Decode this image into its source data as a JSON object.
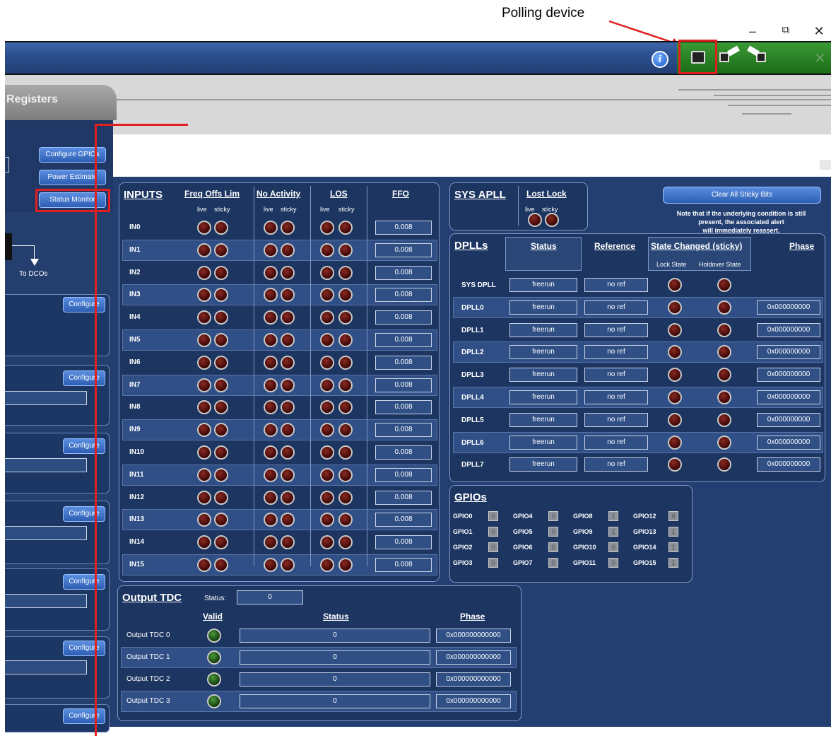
{
  "annotation": {
    "polling_label": "Polling device"
  },
  "window": {
    "minimize": "–",
    "restore": "⧉",
    "close": "✕"
  },
  "toolbar": {
    "info": "i"
  },
  "tab": {
    "label": "Registers"
  },
  "left": {
    "buttons": [
      "Configure GPIOs",
      "Power Estimate",
      "Status Monitor"
    ],
    "to_dcos": "To DCOs",
    "configure": "Configure"
  },
  "inputs": {
    "title": "INPUTS",
    "headers": [
      "Freq Offs Lim",
      "No Activity",
      "LOS",
      "FFO"
    ],
    "sub": [
      "live",
      "sticky"
    ],
    "rows": [
      {
        "name": "IN0",
        "ffo": "0.008"
      },
      {
        "name": "IN1",
        "ffo": "0.008"
      },
      {
        "name": "IN2",
        "ffo": "0.008"
      },
      {
        "name": "IN3",
        "ffo": "0.008"
      },
      {
        "name": "IN4",
        "ffo": "0.008"
      },
      {
        "name": "IN5",
        "ffo": "0.008"
      },
      {
        "name": "IN6",
        "ffo": "0.008"
      },
      {
        "name": "IN7",
        "ffo": "0.008"
      },
      {
        "name": "IN8",
        "ffo": "0.008"
      },
      {
        "name": "IN9",
        "ffo": "0.008"
      },
      {
        "name": "IN10",
        "ffo": "0.008"
      },
      {
        "name": "IN11",
        "ffo": "0.008"
      },
      {
        "name": "IN12",
        "ffo": "0.008"
      },
      {
        "name": "IN13",
        "ffo": "0.008"
      },
      {
        "name": "IN14",
        "ffo": "0.008"
      },
      {
        "name": "IN15",
        "ffo": "0.008"
      }
    ]
  },
  "sysapll": {
    "title": "SYS APLL",
    "header": "Lost Lock",
    "sub": [
      "live",
      "sticky"
    ]
  },
  "clear": {
    "button": "Clear All Sticky Bits",
    "note": [
      "Note that if the underlying condition is still",
      "present, the associated alert",
      "will immediately reassert."
    ]
  },
  "dplls": {
    "title": "DPLLs",
    "headers": [
      "Status",
      "Reference",
      "State Changed (sticky)",
      "Phase"
    ],
    "sub": [
      "Lock State",
      "Holdover State"
    ],
    "rows": [
      {
        "name": "SYS DPLL",
        "status": "freerun",
        "ref": "no ref",
        "phase": ""
      },
      {
        "name": "DPLL0",
        "status": "freerun",
        "ref": "no ref",
        "phase": "0x000000000"
      },
      {
        "name": "DPLL1",
        "status": "freerun",
        "ref": "no ref",
        "phase": "0x000000000"
      },
      {
        "name": "DPLL2",
        "status": "freerun",
        "ref": "no ref",
        "phase": "0x000000000"
      },
      {
        "name": "DPLL3",
        "status": "freerun",
        "ref": "no ref",
        "phase": "0x000000000"
      },
      {
        "name": "DPLL4",
        "status": "freerun",
        "ref": "no ref",
        "phase": "0x000000000"
      },
      {
        "name": "DPLL5",
        "status": "freerun",
        "ref": "no ref",
        "phase": "0x000000000"
      },
      {
        "name": "DPLL6",
        "status": "freerun",
        "ref": "no ref",
        "phase": "0x000000000"
      },
      {
        "name": "DPLL7",
        "status": "freerun",
        "ref": "no ref",
        "phase": "0x000000000"
      }
    ]
  },
  "gpios": {
    "title": "GPIOs",
    "items": [
      {
        "name": "GPIO0",
        "v": "0"
      },
      {
        "name": "GPIO4",
        "v": "0"
      },
      {
        "name": "GPIO8",
        "v": "1"
      },
      {
        "name": "GPIO12",
        "v": "0"
      },
      {
        "name": "GPIO1",
        "v": "0"
      },
      {
        "name": "GPIO5",
        "v": "0"
      },
      {
        "name": "GPIO9",
        "v": "1"
      },
      {
        "name": "GPIO13",
        "v": "1"
      },
      {
        "name": "GPIO2",
        "v": "0"
      },
      {
        "name": "GPIO6",
        "v": "0"
      },
      {
        "name": "GPIO10",
        "v": "0"
      },
      {
        "name": "GPIO14",
        "v": "1"
      },
      {
        "name": "GPIO3",
        "v": "0"
      },
      {
        "name": "GPIO7",
        "v": "0"
      },
      {
        "name": "GPIO11",
        "v": "0"
      },
      {
        "name": "GPIO15",
        "v": "1"
      }
    ]
  },
  "tdc": {
    "title": "Output TDC",
    "status_label": "Status:",
    "status_value": "0",
    "headers": [
      "Valid",
      "Status",
      "Phase"
    ],
    "rows": [
      {
        "name": "Output TDC 0",
        "status": "0",
        "phase": "0x000000000000"
      },
      {
        "name": "Output TDC 1",
        "status": "0",
        "phase": "0x000000000000"
      },
      {
        "name": "Output TDC 2",
        "status": "0",
        "phase": "0x000000000000"
      },
      {
        "name": "Output TDC 3",
        "status": "0",
        "phase": "0x000000000000"
      }
    ]
  }
}
